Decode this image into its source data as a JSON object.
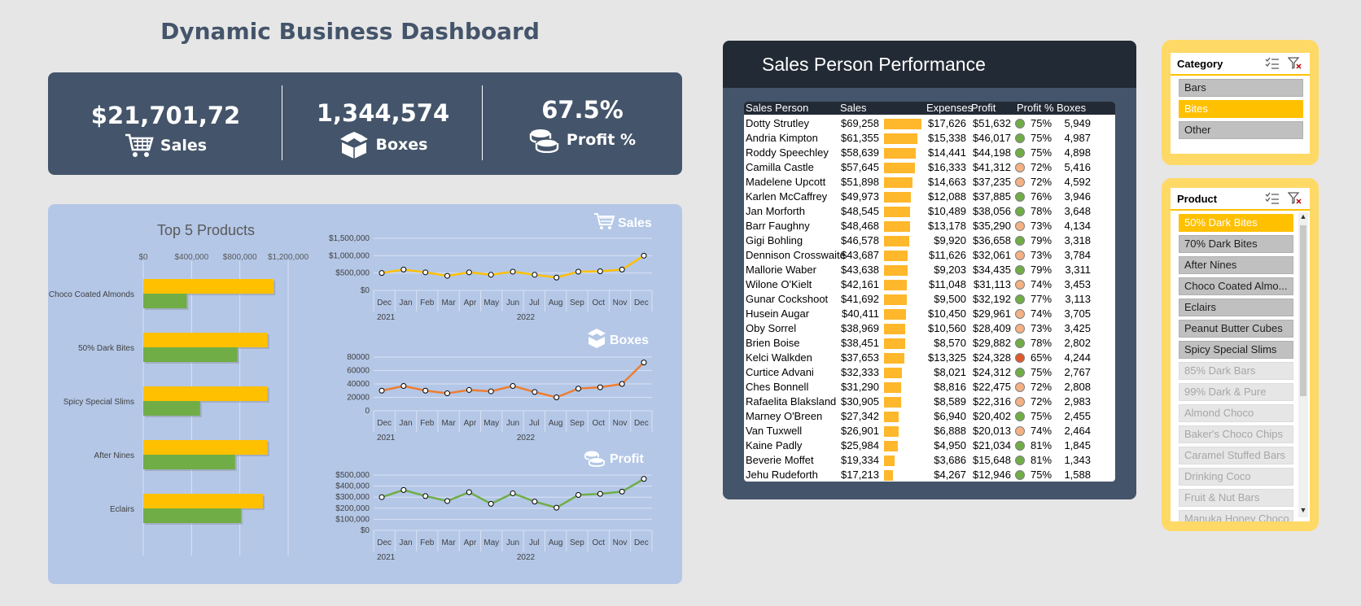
{
  "title": "Dynamic Business Dashboard",
  "kpis": {
    "sales": {
      "value": "$21,701,72",
      "label": "Sales",
      "icon": "cart-icon"
    },
    "boxes": {
      "value": "1,344,574",
      "label": "Boxes",
      "icon": "box-icon"
    },
    "profit": {
      "value": "67.5%",
      "label": "Profit %",
      "icon": "coins-icon"
    }
  },
  "top5": {
    "title": "Top 5 Products",
    "x_ticks": [
      "$0",
      "$400,000",
      "$800,000",
      "$1,200,000"
    ],
    "series_colors": [
      "#ffc000",
      "#70ad47"
    ]
  },
  "line_panels": {
    "sales_label": "Sales",
    "boxes_label": "Boxes",
    "profit_label": "Profit",
    "months": [
      "Dec",
      "Jan",
      "Feb",
      "Mar",
      "Apr",
      "May",
      "Jun",
      "Jul",
      "Aug",
      "Sep",
      "Oct",
      "Nov",
      "Dec"
    ],
    "years": [
      "2021",
      "2022"
    ],
    "sales_ticks": [
      "$1,500,000",
      "$1,000,000",
      "$500,000",
      "$0"
    ],
    "boxes_ticks": [
      "80000",
      "60000",
      "40000",
      "20000",
      "0"
    ],
    "profit_ticks": [
      "$500,000",
      "$400,000",
      "$300,000",
      "$200,000",
      "$100,000",
      "$0"
    ]
  },
  "chart_data": [
    {
      "type": "bar",
      "title": "Top 5 Products",
      "categories": [
        "Choco Coated Almonds",
        "50% Dark Bites",
        "Spicy Special Slims",
        "After Nines",
        "Eclairs"
      ],
      "series": [
        {
          "values": [
            1080000,
            1030000,
            1030000,
            1030000,
            990000
          ]
        },
        {
          "values": [
            360000,
            780000,
            470000,
            760000,
            810000
          ]
        }
      ],
      "xlim": [
        0,
        1200000
      ],
      "orientation": "horizontal"
    },
    {
      "type": "line",
      "title": "Sales",
      "x": [
        "Dec 2021",
        "Jan",
        "Feb",
        "Mar",
        "Apr",
        "May",
        "Jun",
        "Jul",
        "Aug",
        "Sep",
        "Oct",
        "Nov",
        "Dec"
      ],
      "values": [
        500000,
        600000,
        520000,
        420000,
        520000,
        450000,
        540000,
        450000,
        370000,
        540000,
        550000,
        600000,
        1000000
      ],
      "ylim": [
        0,
        1500000
      ],
      "color": "#ffc000"
    },
    {
      "type": "line",
      "title": "Boxes",
      "x": [
        "Dec 2021",
        "Jan",
        "Feb",
        "Mar",
        "Apr",
        "May",
        "Jun",
        "Jul",
        "Aug",
        "Sep",
        "Oct",
        "Nov",
        "Dec"
      ],
      "values": [
        30000,
        37000,
        30000,
        26000,
        31000,
        29000,
        37000,
        28000,
        20000,
        33000,
        35000,
        40000,
        72000
      ],
      "ylim": [
        0,
        80000
      ],
      "color": "#ed7d31"
    },
    {
      "type": "line",
      "title": "Profit",
      "x": [
        "Dec 2021",
        "Jan",
        "Feb",
        "Mar",
        "Apr",
        "May",
        "Jun",
        "Jul",
        "Aug",
        "Sep",
        "Oct",
        "Nov",
        "Dec"
      ],
      "values": [
        300000,
        365000,
        310000,
        265000,
        345000,
        240000,
        335000,
        260000,
        205000,
        320000,
        330000,
        350000,
        465000
      ],
      "ylim": [
        0,
        500000
      ],
      "color": "#70ad47"
    }
  ],
  "sales_person": {
    "title": "Sales Person Performance",
    "headers": [
      "Sales Person",
      "Sales",
      "Expenses",
      "Profit",
      "Profit %",
      "Boxes"
    ],
    "max_sales": 69258,
    "rows": [
      {
        "name": "Dotty Strutley",
        "sales": "$69,258",
        "sales_num": 69258,
        "expenses": "$17,626",
        "profit": "$51,632",
        "pct": "75%",
        "status": "#70ad47",
        "boxes": "5,949"
      },
      {
        "name": "Andria Kimpton",
        "sales": "$61,355",
        "sales_num": 61355,
        "expenses": "$15,338",
        "profit": "$46,017",
        "pct": "75%",
        "status": "#70ad47",
        "boxes": "4,987"
      },
      {
        "name": "Roddy Speechley",
        "sales": "$58,639",
        "sales_num": 58639,
        "expenses": "$14,441",
        "profit": "$44,198",
        "pct": "75%",
        "status": "#70ad47",
        "boxes": "4,898"
      },
      {
        "name": "Camilla Castle",
        "sales": "$57,645",
        "sales_num": 57645,
        "expenses": "$16,333",
        "profit": "$41,312",
        "pct": "72%",
        "status": "#f4b183",
        "boxes": "5,416"
      },
      {
        "name": "Madelene Upcott",
        "sales": "$51,898",
        "sales_num": 51898,
        "expenses": "$14,663",
        "profit": "$37,235",
        "pct": "72%",
        "status": "#f4b183",
        "boxes": "4,592"
      },
      {
        "name": "Karlen McCaffrey",
        "sales": "$49,973",
        "sales_num": 49973,
        "expenses": "$12,088",
        "profit": "$37,885",
        "pct": "76%",
        "status": "#70ad47",
        "boxes": "3,946"
      },
      {
        "name": "Jan Morforth",
        "sales": "$48,545",
        "sales_num": 48545,
        "expenses": "$10,489",
        "profit": "$38,056",
        "pct": "78%",
        "status": "#70ad47",
        "boxes": "3,648"
      },
      {
        "name": "Barr Faughny",
        "sales": "$48,468",
        "sales_num": 48468,
        "expenses": "$13,178",
        "profit": "$35,290",
        "pct": "73%",
        "status": "#f4b183",
        "boxes": "4,134"
      },
      {
        "name": "Gigi Bohling",
        "sales": "$46,578",
        "sales_num": 46578,
        "expenses": "$9,920",
        "profit": "$36,658",
        "pct": "79%",
        "status": "#70ad47",
        "boxes": "3,318"
      },
      {
        "name": "Dennison Crosswaite",
        "sales": "$43,687",
        "sales_num": 43687,
        "expenses": "$11,626",
        "profit": "$32,061",
        "pct": "73%",
        "status": "#f4b183",
        "boxes": "3,784"
      },
      {
        "name": "Mallorie Waber",
        "sales": "$43,638",
        "sales_num": 43638,
        "expenses": "$9,203",
        "profit": "$34,435",
        "pct": "79%",
        "status": "#70ad47",
        "boxes": "3,311"
      },
      {
        "name": "Wilone O'Kielt",
        "sales": "$42,161",
        "sales_num": 42161,
        "expenses": "$11,048",
        "profit": "$31,113",
        "pct": "74%",
        "status": "#f4b183",
        "boxes": "3,453"
      },
      {
        "name": "Gunar Cockshoot",
        "sales": "$41,692",
        "sales_num": 41692,
        "expenses": "$9,500",
        "profit": "$32,192",
        "pct": "77%",
        "status": "#70ad47",
        "boxes": "3,113"
      },
      {
        "name": "Husein Augar",
        "sales": "$40,411",
        "sales_num": 40411,
        "expenses": "$10,450",
        "profit": "$29,961",
        "pct": "74%",
        "status": "#f4b183",
        "boxes": "3,705"
      },
      {
        "name": "Oby Sorrel",
        "sales": "$38,969",
        "sales_num": 38969,
        "expenses": "$10,560",
        "profit": "$28,409",
        "pct": "73%",
        "status": "#f4b183",
        "boxes": "3,425"
      },
      {
        "name": "Brien Boise",
        "sales": "$38,451",
        "sales_num": 38451,
        "expenses": "$8,570",
        "profit": "$29,882",
        "pct": "78%",
        "status": "#70ad47",
        "boxes": "2,802"
      },
      {
        "name": "Kelci Walkden",
        "sales": "$37,653",
        "sales_num": 37653,
        "expenses": "$13,325",
        "profit": "$24,328",
        "pct": "65%",
        "status": "#e05a2b",
        "boxes": "4,244"
      },
      {
        "name": "Curtice Advani",
        "sales": "$32,333",
        "sales_num": 32333,
        "expenses": "$8,021",
        "profit": "$24,312",
        "pct": "75%",
        "status": "#70ad47",
        "boxes": "2,767"
      },
      {
        "name": "Ches Bonnell",
        "sales": "$31,290",
        "sales_num": 31290,
        "expenses": "$8,816",
        "profit": "$22,475",
        "pct": "72%",
        "status": "#f4b183",
        "boxes": "2,808"
      },
      {
        "name": "Rafaelita Blaksland",
        "sales": "$30,905",
        "sales_num": 30905,
        "expenses": "$8,589",
        "profit": "$22,316",
        "pct": "72%",
        "status": "#f4b183",
        "boxes": "2,983"
      },
      {
        "name": "Marney O'Breen",
        "sales": "$27,342",
        "sales_num": 27342,
        "expenses": "$6,940",
        "profit": "$20,402",
        "pct": "75%",
        "status": "#70ad47",
        "boxes": "2,455"
      },
      {
        "name": "Van Tuxwell",
        "sales": "$26,901",
        "sales_num": 26901,
        "expenses": "$6,888",
        "profit": "$20,013",
        "pct": "74%",
        "status": "#f4b183",
        "boxes": "2,464"
      },
      {
        "name": "Kaine Padly",
        "sales": "$25,984",
        "sales_num": 25984,
        "expenses": "$4,950",
        "profit": "$21,034",
        "pct": "81%",
        "status": "#70ad47",
        "boxes": "1,845"
      },
      {
        "name": "Beverie Moffet",
        "sales": "$19,334",
        "sales_num": 19334,
        "expenses": "$3,686",
        "profit": "$15,648",
        "pct": "81%",
        "status": "#70ad47",
        "boxes": "1,343"
      },
      {
        "name": "Jehu Rudeforth",
        "sales": "$17,213",
        "sales_num": 17213,
        "expenses": "$4,267",
        "profit": "$12,946",
        "pct": "75%",
        "status": "#70ad47",
        "boxes": "1,588"
      }
    ]
  },
  "category_slicer": {
    "title": "Category",
    "items": [
      {
        "label": "Bars",
        "state": "avail"
      },
      {
        "label": "Bites",
        "state": "sel"
      },
      {
        "label": "Other",
        "state": "avail"
      }
    ]
  },
  "product_slicer": {
    "title": "Product",
    "items": [
      {
        "label": "50% Dark Bites",
        "state": "sel"
      },
      {
        "label": "70% Dark Bites",
        "state": "avail"
      },
      {
        "label": "After Nines",
        "state": "avail"
      },
      {
        "label": "Choco Coated Almo...",
        "state": "avail"
      },
      {
        "label": "Eclairs",
        "state": "avail"
      },
      {
        "label": "Peanut Butter Cubes",
        "state": "avail"
      },
      {
        "label": "Spicy Special Slims",
        "state": "avail"
      },
      {
        "label": "85% Dark Bars",
        "state": "none"
      },
      {
        "label": "99% Dark & Pure",
        "state": "none"
      },
      {
        "label": "Almond Choco",
        "state": "none"
      },
      {
        "label": "Baker's Choco Chips",
        "state": "none"
      },
      {
        "label": "Caramel Stuffed Bars",
        "state": "none"
      },
      {
        "label": "Drinking Coco",
        "state": "none"
      },
      {
        "label": "Fruit & Nut Bars",
        "state": "none"
      },
      {
        "label": "Manuka Honey Choco",
        "state": "none"
      }
    ]
  }
}
